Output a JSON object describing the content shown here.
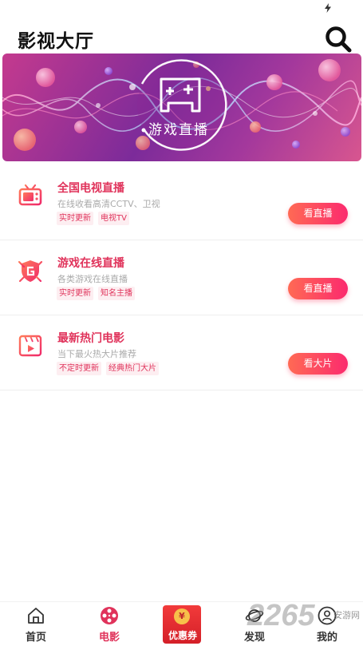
{
  "header": {
    "title": "影视大厅"
  },
  "banner": {
    "text": "游戏直播"
  },
  "items": [
    {
      "title": "全国电视直播",
      "subtitle": "在线收看高清CCTV、卫视",
      "tags": [
        "实时更新",
        "电视TV"
      ],
      "button": "看直播",
      "icon": "tv-icon"
    },
    {
      "title": "游戏在线直播",
      "subtitle": "各类游戏在线直播",
      "tags": [
        "实时更新",
        "知名主播"
      ],
      "button": "看直播",
      "icon": "game-shield-icon"
    },
    {
      "title": "最新热门电影",
      "subtitle": "当下最火热大片推荐",
      "tags": [
        "不定时更新",
        "经典热门大片"
      ],
      "button": "看大片",
      "icon": "film-icon"
    }
  ],
  "tabbar": {
    "tabs": [
      {
        "label": "首页",
        "icon": "home-icon"
      },
      {
        "label": "电影",
        "icon": "film-reel-icon",
        "active": true
      },
      {
        "label": "优惠券",
        "icon": "coupon-icon"
      },
      {
        "label": "发现",
        "icon": "planet-icon"
      },
      {
        "label": "我的",
        "icon": "user-icon"
      }
    ],
    "coupon_coin": "¥"
  },
  "watermark": {
    "big": "2265",
    "small": "安游网"
  },
  "colors": {
    "accent": "#e0335b",
    "button_gradient_start": "#ff6a54",
    "button_gradient_end": "#fb2a6e"
  }
}
